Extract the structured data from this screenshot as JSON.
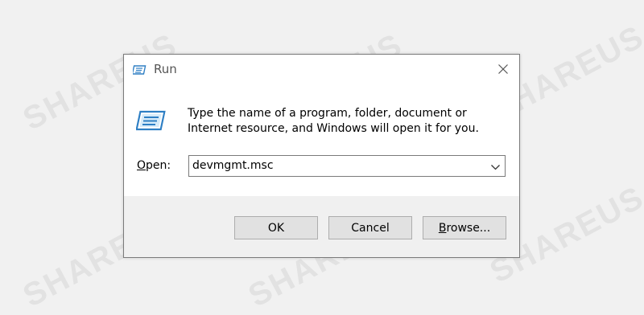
{
  "watermark": {
    "text": "SHAREUS"
  },
  "dialog": {
    "title": "Run",
    "description": "Type the name of a program, folder, document or Internet resource, and Windows will open it for you.",
    "open_label_accel": "O",
    "open_label_rest": "pen:",
    "open_value": "devmgmt.msc",
    "buttons": {
      "ok": "OK",
      "cancel": "Cancel",
      "browse_accel": "B",
      "browse_rest": "rowse..."
    }
  },
  "icons": {
    "title": "run-icon",
    "main": "run-icon",
    "close": "close-icon",
    "dropdown": "chevron-down-icon"
  },
  "colors": {
    "background": "#f1f1f1",
    "dialog_bg": "#ffffff",
    "footer_bg": "#f0f0f0",
    "button_bg": "#e1e1e1",
    "icon_blue": "#2e7fc4"
  }
}
